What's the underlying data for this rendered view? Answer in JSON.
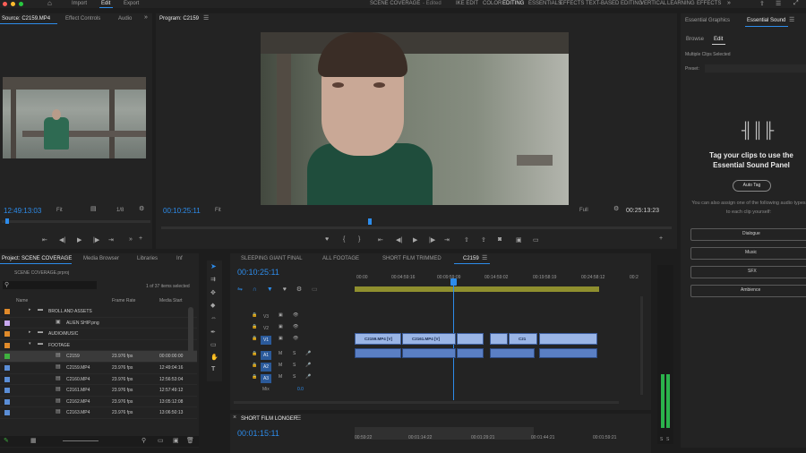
{
  "window": {
    "top_nav": [
      "Import",
      "Edit",
      "Export"
    ],
    "active": "Edit",
    "project_title": "SCENE COVERAGE",
    "status": "- Edited",
    "workspaces": [
      "IKE EDIT",
      "COLOR",
      "EDITING",
      "ESSENTIALS",
      "EFFECTS",
      "TEXT-BASED EDITING",
      "VERTICAL",
      "LEARNING",
      "EFFECTS"
    ],
    "active_workspace": "EDITING"
  },
  "source": {
    "tab": "Source: C2159.MP4",
    "tabs2": [
      "Effect Controls",
      "Audio"
    ],
    "timecode": "12:49:13:03",
    "fit": "Fit",
    "fraction": "1/8"
  },
  "program": {
    "tab": "Program: C2159",
    "timecode": "00:10:25:11",
    "fit": "Fit",
    "quality": "Full",
    "duration": "00:25:13:23"
  },
  "essential": {
    "tabs": [
      "Essential Graphics",
      "Essential Sound"
    ],
    "sub_tabs": [
      "Browse",
      "Edit"
    ],
    "selected_msg": "Multiple Clips Selected",
    "preset": "Preset:",
    "headline": "Tag your clips to use the Essential Sound Panel",
    "autotag": "Auto Tag",
    "assign_msg": "You can also assign one of the following audio types to each clip yourself:",
    "types": [
      "Dialogue",
      "Music",
      "SFX",
      "Ambience"
    ]
  },
  "project": {
    "tabs": [
      "Project: SCENE COVERAGE",
      "Media Browser",
      "Libraries",
      "Inf"
    ],
    "file": "SCENE COVERAGE.prproj",
    "items_selected": "1 of 37 items selected",
    "cols": [
      "Name",
      "Frame Rate",
      "Media Start"
    ],
    "rows": [
      {
        "name": "BROLL AND ASSETS",
        "fps": "",
        "start": "",
        "color": "#e08a2a",
        "kind": "folder"
      },
      {
        "name": "ALIEN SHIP.png",
        "fps": "",
        "start": "",
        "color": "#c7a7ef",
        "kind": "image"
      },
      {
        "name": "AUDIO/MUSIC",
        "fps": "",
        "start": "",
        "color": "#e08a2a",
        "kind": "folder"
      },
      {
        "name": "FOOTAGE",
        "fps": "",
        "start": "",
        "color": "#e08a2a",
        "kind": "folder"
      },
      {
        "name": "C2159",
        "fps": "23.976 fps",
        "start": "00:00:00:00",
        "color": "#3fb13f",
        "kind": "sequence"
      },
      {
        "name": "C2159.MP4",
        "fps": "23.976 fps",
        "start": "12:49:04:16",
        "color": "#5b8ed6",
        "kind": "clip"
      },
      {
        "name": "C2160.MP4",
        "fps": "23.976 fps",
        "start": "12:56:53:04",
        "color": "#5b8ed6",
        "kind": "clip"
      },
      {
        "name": "C2161.MP4",
        "fps": "23.976 fps",
        "start": "12:57:49:12",
        "color": "#5b8ed6",
        "kind": "clip"
      },
      {
        "name": "C2162.MP4",
        "fps": "23.976 fps",
        "start": "13:05:12:08",
        "color": "#5b8ed6",
        "kind": "clip"
      },
      {
        "name": "C2163.MP4",
        "fps": "23.976 fps",
        "start": "13:06:50:13",
        "color": "#5b8ed6",
        "kind": "clip"
      }
    ]
  },
  "timeline": {
    "tabs": [
      "SLEEPING GIANT FINAL",
      "ALL FOOTAGE",
      "SHORT FILM TRIMMED",
      "C2159"
    ],
    "active_tab": "C2159",
    "timecode": "00:10:25:11",
    "ruler": [
      "00:00",
      "00:04:59:16",
      "00:09:59:09",
      "00:14:59:02",
      "00:19:58:19",
      "00:24:58:12",
      "00:2"
    ],
    "tracks": [
      "V3",
      "V2",
      "V1",
      "A1",
      "A2",
      "A3"
    ],
    "mix": "Mix",
    "mix_val": "0.0",
    "video_clips": [
      "C2159.MP4 [V]",
      "C2161.MP4 [V]",
      "C21"
    ],
    "meter_vals": [
      "S",
      "S"
    ]
  },
  "timeline2": {
    "tab": "SHORT FILM LONGER",
    "timecode": "00:01:15:11",
    "ruler": [
      "00:59:22",
      "00:01:14:22",
      "00:01:29:21",
      "00:01:44:21",
      "00:01:59:21"
    ]
  }
}
